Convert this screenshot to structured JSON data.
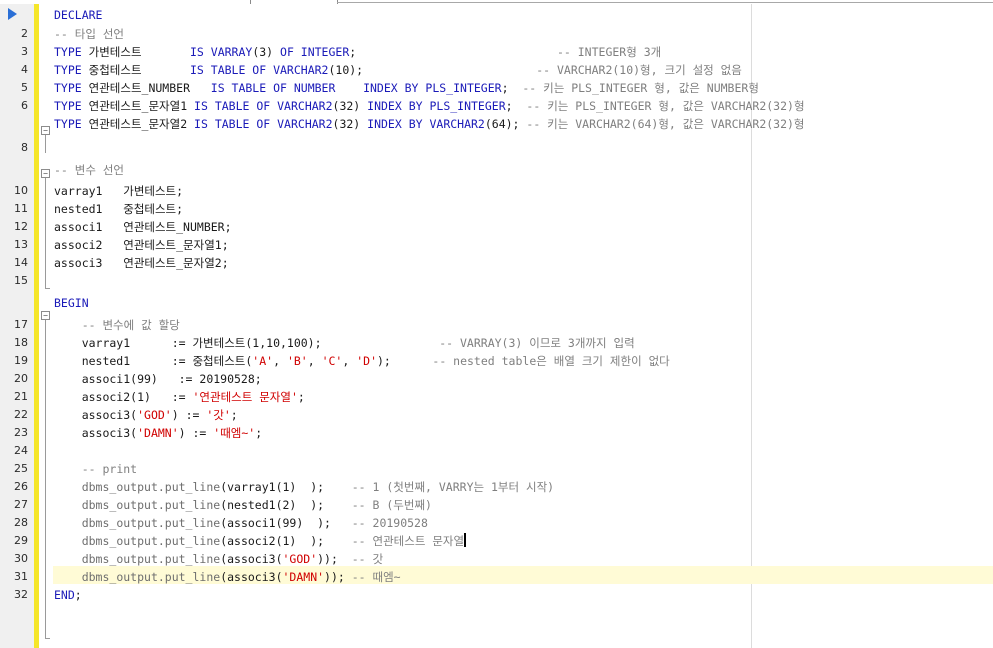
{
  "gutter": {
    "line_numbers": [
      "",
      "2",
      "3",
      "4",
      "5",
      "6",
      "",
      "8",
      "",
      "10",
      "11",
      "12",
      "13",
      "14",
      "15",
      "",
      "17",
      "18",
      "19",
      "20",
      "21",
      "22",
      "23",
      "24",
      "25",
      "26",
      "27",
      "28",
      "29",
      "30",
      "31",
      "32"
    ],
    "run_marker_icon": "play-triangle-icon",
    "fold_icon": "fold-minus-icon"
  },
  "colors": {
    "keyword": "#1a1ab8",
    "comment": "#7f7f7f",
    "string": "#d00000",
    "change_bar": "#f5e62a",
    "current_line": "#fffbd6"
  },
  "editor": {
    "lines": [
      [
        {
          "t": "DECLARE",
          "c": "kw"
        }
      ],
      [
        {
          "t": "-- 타입 선언",
          "c": "cm"
        }
      ],
      [
        {
          "t": "TYPE ",
          "c": "kw"
        },
        {
          "t": "가변테스트       ",
          "c": "id"
        },
        {
          "t": "IS VARRAY",
          "c": "kw"
        },
        {
          "t": "(3) ",
          "c": "nm"
        },
        {
          "t": "OF INTEGER",
          "c": "kw"
        },
        {
          "t": ";                             ",
          "c": "id"
        },
        {
          "t": "-- INTEGER형 3개",
          "c": "cm"
        }
      ],
      [
        {
          "t": "TYPE ",
          "c": "kw"
        },
        {
          "t": "중첩테스트       ",
          "c": "id"
        },
        {
          "t": "IS TABLE OF VARCHAR2",
          "c": "kw"
        },
        {
          "t": "(10);                         ",
          "c": "nm"
        },
        {
          "t": "-- VARCHAR2(10)형, 크기 설정 없음",
          "c": "cm"
        }
      ],
      [
        {
          "t": "TYPE ",
          "c": "kw"
        },
        {
          "t": "연관테스트_NUMBER   ",
          "c": "id"
        },
        {
          "t": "IS TABLE OF NUMBER    INDEX BY PLS_INTEGER",
          "c": "kw"
        },
        {
          "t": ";  ",
          "c": "id"
        },
        {
          "t": "-- 키는 PLS_INTEGER 형, 값은 NUMBER형",
          "c": "cm"
        }
      ],
      [
        {
          "t": "TYPE ",
          "c": "kw"
        },
        {
          "t": "연관테스트_문자열1 ",
          "c": "id"
        },
        {
          "t": "IS TABLE OF VARCHAR2",
          "c": "kw"
        },
        {
          "t": "(32) ",
          "c": "nm"
        },
        {
          "t": "INDEX BY PLS_INTEGER",
          "c": "kw"
        },
        {
          "t": ";  ",
          "c": "id"
        },
        {
          "t": "-- 키는 PLS_INTEGER 형, 값은 VARCHAR2(32)형",
          "c": "cm"
        }
      ],
      [
        {
          "t": "TYPE ",
          "c": "kw"
        },
        {
          "t": "연관테스트_문자열2 ",
          "c": "id"
        },
        {
          "t": "IS TABLE OF VARCHAR2",
          "c": "kw"
        },
        {
          "t": "(32) ",
          "c": "nm"
        },
        {
          "t": "INDEX BY VARCHAR2",
          "c": "kw"
        },
        {
          "t": "(64); ",
          "c": "nm"
        },
        {
          "t": "-- 키는 VARCHAR2(64)형, 값은 VARCHAR2(32)형",
          "c": "cm"
        }
      ],
      [],
      [
        {
          "t": "-- 변수 선언",
          "c": "cm"
        }
      ],
      [
        {
          "t": "varray1   가변테스트;",
          "c": "id"
        }
      ],
      [
        {
          "t": "nested1   중첩테스트;",
          "c": "id"
        }
      ],
      [
        {
          "t": "associ1   연관테스트_NUMBER;",
          "c": "id"
        }
      ],
      [
        {
          "t": "associ2   연관테스트_문자열1;",
          "c": "id"
        }
      ],
      [
        {
          "t": "associ3   연관테스트_문자열2;",
          "c": "id"
        }
      ],
      [],
      [
        {
          "t": "BEGIN",
          "c": "kw"
        }
      ],
      [
        {
          "t": "    ",
          "c": "id"
        },
        {
          "t": "-- 변수에 값 할당",
          "c": "cm"
        }
      ],
      [
        {
          "t": "    varray1      := 가변테스트(1,10,100);                 ",
          "c": "id"
        },
        {
          "t": "-- VARRAY(3) 이므로 3개까지 입력",
          "c": "cm"
        }
      ],
      [
        {
          "t": "    nested1      := 중첩테스트(",
          "c": "id"
        },
        {
          "t": "'A'",
          "c": "st"
        },
        {
          "t": ", ",
          "c": "id"
        },
        {
          "t": "'B'",
          "c": "st"
        },
        {
          "t": ", ",
          "c": "id"
        },
        {
          "t": "'C'",
          "c": "st"
        },
        {
          "t": ", ",
          "c": "id"
        },
        {
          "t": "'D'",
          "c": "st"
        },
        {
          "t": ");      ",
          "c": "id"
        },
        {
          "t": "-- nested table은 배열 크기 제한이 없다",
          "c": "cm"
        }
      ],
      [
        {
          "t": "    associ1(99)   := 20190528;",
          "c": "id"
        }
      ],
      [
        {
          "t": "    associ2(1)   := ",
          "c": "id"
        },
        {
          "t": "'연관테스트 문자열'",
          "c": "st"
        },
        {
          "t": ";",
          "c": "id"
        }
      ],
      [
        {
          "t": "    associ3(",
          "c": "id"
        },
        {
          "t": "'GOD'",
          "c": "st"
        },
        {
          "t": ") := ",
          "c": "id"
        },
        {
          "t": "'갓'",
          "c": "st"
        },
        {
          "t": ";",
          "c": "id"
        }
      ],
      [
        {
          "t": "    associ3(",
          "c": "id"
        },
        {
          "t": "'DAMN'",
          "c": "st"
        },
        {
          "t": ") := ",
          "c": "id"
        },
        {
          "t": "'때엠~'",
          "c": "st"
        },
        {
          "t": ";",
          "c": "id"
        }
      ],
      [],
      [
        {
          "t": "    ",
          "c": "id"
        },
        {
          "t": "-- print",
          "c": "cm"
        }
      ],
      [
        {
          "t": "    ",
          "c": "id"
        },
        {
          "t": "dbms_output.put_line",
          "c": "fn"
        },
        {
          "t": "(varray1(1)  );    ",
          "c": "id"
        },
        {
          "t": "-- 1 (첫번째, VARRY는 1부터 시작)",
          "c": "cm"
        }
      ],
      [
        {
          "t": "    ",
          "c": "id"
        },
        {
          "t": "dbms_output.put_line",
          "c": "fn"
        },
        {
          "t": "(nested1(2)  );    ",
          "c": "id"
        },
        {
          "t": "-- B (두번째)",
          "c": "cm"
        }
      ],
      [
        {
          "t": "    ",
          "c": "id"
        },
        {
          "t": "dbms_output.put_line",
          "c": "fn"
        },
        {
          "t": "(associ1(99)  );   ",
          "c": "id"
        },
        {
          "t": "-- 20190528",
          "c": "cm"
        }
      ],
      [
        {
          "t": "    ",
          "c": "id"
        },
        {
          "t": "dbms_output.put_line",
          "c": "fn"
        },
        {
          "t": "(associ2(1)  );    ",
          "c": "id"
        },
        {
          "t": "-- 연관테스트 문자열",
          "c": "cm"
        }
      ],
      [
        {
          "t": "    ",
          "c": "id"
        },
        {
          "t": "dbms_output.put_line",
          "c": "fn"
        },
        {
          "t": "(associ3(",
          "c": "id"
        },
        {
          "t": "'GOD'",
          "c": "st"
        },
        {
          "t": "));  ",
          "c": "id"
        },
        {
          "t": "-- 갓",
          "c": "cm"
        }
      ],
      [
        {
          "t": "    ",
          "c": "id"
        },
        {
          "t": "dbms_output.put_line",
          "c": "fn"
        },
        {
          "t": "(associ3(",
          "c": "id"
        },
        {
          "t": "'DAMN'",
          "c": "st"
        },
        {
          "t": ")); ",
          "c": "id"
        },
        {
          "t": "-- 때엠~",
          "c": "cm"
        }
      ],
      [
        {
          "t": "END",
          "c": "kw"
        },
        {
          "t": ";",
          "c": "id"
        }
      ]
    ],
    "caret_line": 28
  }
}
